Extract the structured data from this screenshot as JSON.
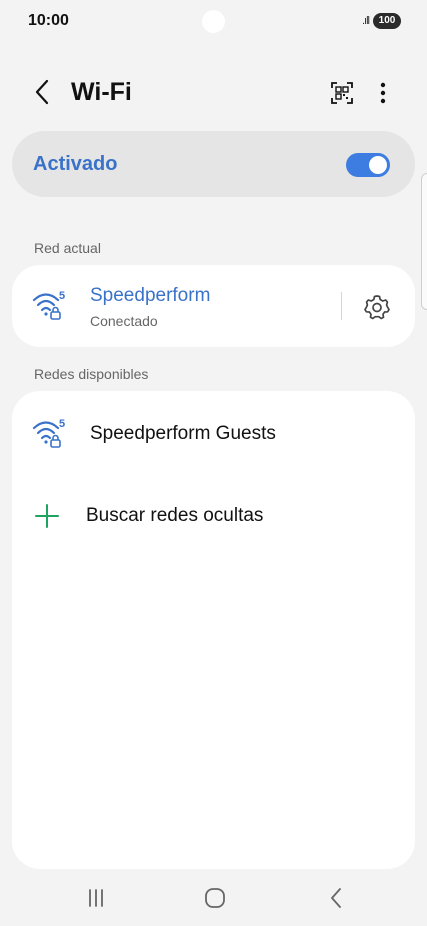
{
  "status_bar": {
    "time": "10:00",
    "signal": ".ıll",
    "battery": "100"
  },
  "header": {
    "title": "Wi-Fi"
  },
  "wifi_toggle": {
    "label": "Activado",
    "state": "on",
    "accent_color": "#3d7de1"
  },
  "current_network": {
    "section_title": "Red actual",
    "name": "Speedperform",
    "status": "Conectado",
    "band_label": "5",
    "icon": "wifi-5ghz-lock-icon"
  },
  "available_networks": {
    "section_title": "Redes disponibles",
    "items": [
      {
        "name": "Speedperform Guests",
        "band_label": "5",
        "icon": "wifi-5ghz-lock-icon"
      }
    ],
    "add_hidden_label": "Buscar redes ocultas"
  },
  "nav_bar": {
    "icons": [
      "recent-apps-icon",
      "home-icon",
      "back-icon"
    ]
  }
}
